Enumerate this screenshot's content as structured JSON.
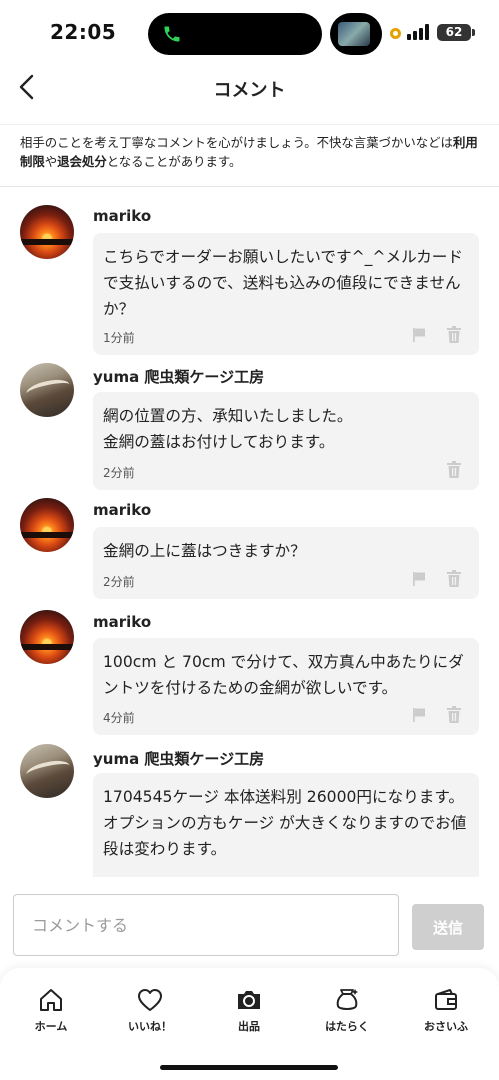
{
  "status_bar": {
    "time": "22:05",
    "battery": "62"
  },
  "header": {
    "title": "コメント"
  },
  "notice": {
    "part1": "相手のことを考え丁寧なコメントを心がけましょう。不快な言葉づかいなどは",
    "bold1": "利用制限",
    "part2": "や",
    "bold2": "退会処分",
    "part3": "となることがあります。"
  },
  "comments": [
    {
      "user": "mariko",
      "avatar": "sunset",
      "text": "こちらでオーダーお願いしたいです^_^メルカードで支払いするので、送料も込みの値段にできませんか？",
      "time": "1分前",
      "flag": true
    },
    {
      "user": "yuma 爬虫類ケージ工房",
      "avatar": "snake",
      "text": "網の位置の方、承知いたしました。\n金網の蓋はお付けしております。",
      "time": "2分前",
      "flag": false
    },
    {
      "user": "mariko",
      "avatar": "sunset",
      "text": "金網の上に蓋はつきますか？",
      "time": "2分前",
      "flag": true
    },
    {
      "user": "mariko",
      "avatar": "sunset",
      "text": "100cm と 70cm で分けて、双方真ん中あたりにダントツを付けるための金網が欲しいです。",
      "time": "4分前",
      "flag": true
    },
    {
      "user": "yuma 爬虫類ケージ工房",
      "avatar": "snake",
      "text": "1704545ケージ 本体送料別 26000円になります。\nオプションの方もケージ が大きくなりますのでお値段は変わります。",
      "time": "",
      "flag": false
    }
  ],
  "input": {
    "placeholder": "コメントする",
    "send_label": "送信"
  },
  "tabs": [
    {
      "label": "ホーム",
      "icon": "home-icon"
    },
    {
      "label": "いいね！",
      "icon": "heart-icon"
    },
    {
      "label": "出品",
      "icon": "camera-icon"
    },
    {
      "label": "はたらく",
      "icon": "money-bag-icon"
    },
    {
      "label": "おさいふ",
      "icon": "wallet-icon"
    }
  ],
  "colors": {
    "send_button": "#cfcfcf",
    "bubble": "#f3f3f3",
    "icon_gray": "#cccccc"
  }
}
